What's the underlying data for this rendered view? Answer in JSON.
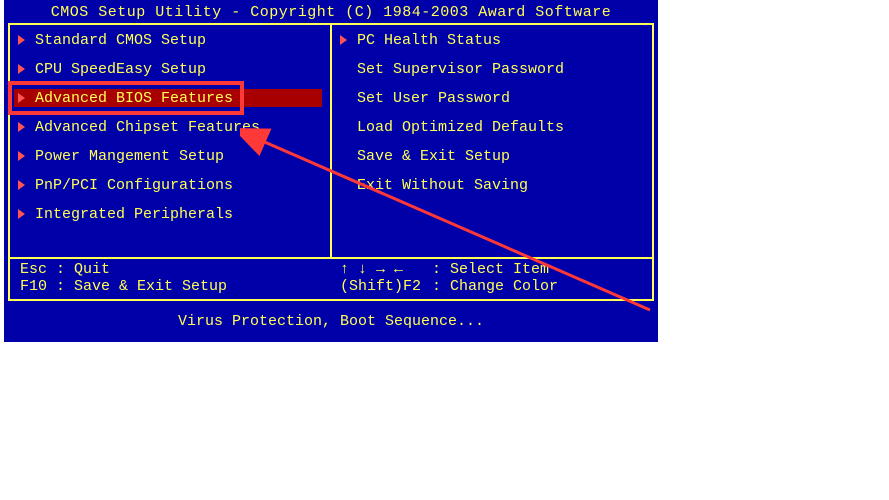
{
  "title": "CMOS Setup Utility - Copyright (C) 1984-2003 Award Software",
  "left_menu": [
    {
      "label": "Standard CMOS Setup",
      "has_triangle": true,
      "highlighted": false
    },
    {
      "label": "CPU SpeedEasy Setup",
      "has_triangle": true,
      "highlighted": false
    },
    {
      "label": "Advanced BIOS Features",
      "has_triangle": true,
      "highlighted": true
    },
    {
      "label": "Advanced Chipset Features",
      "has_triangle": true,
      "highlighted": false
    },
    {
      "label": "Power Mangement Setup",
      "has_triangle": true,
      "highlighted": false
    },
    {
      "label": "PnP/PCI Configurations",
      "has_triangle": true,
      "highlighted": false
    },
    {
      "label": "Integrated Peripherals",
      "has_triangle": true,
      "highlighted": false
    }
  ],
  "right_menu": [
    {
      "label": "PC Health Status",
      "has_triangle": true,
      "highlighted": false
    },
    {
      "label": "Set Supervisor Password",
      "has_triangle": false,
      "highlighted": false
    },
    {
      "label": "Set User Password",
      "has_triangle": false,
      "highlighted": false
    },
    {
      "label": "Load Optimized Defaults",
      "has_triangle": false,
      "highlighted": false
    },
    {
      "label": "Save & Exit Setup",
      "has_triangle": false,
      "highlighted": false
    },
    {
      "label": "Exit Without Saving",
      "has_triangle": false,
      "highlighted": false
    }
  ],
  "help": {
    "line1_left": "Esc : Quit",
    "line1_mid": "↑ ↓ → ←",
    "line1_right": ": Select Item",
    "line2_left": "F10 : Save & Exit Setup",
    "line2_mid": "(Shift)F2",
    "line2_right": ": Change Color"
  },
  "status": "Virus Protection, Boot Sequence..."
}
